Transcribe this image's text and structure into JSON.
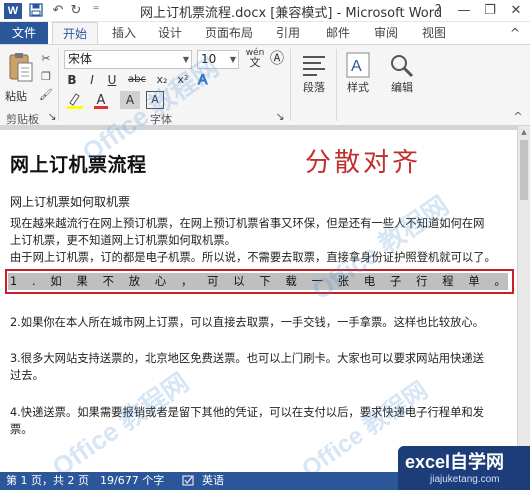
{
  "window": {
    "app_logo": "W",
    "title": "网上订机票流程.docx [兼容模式] - Microsoft Word",
    "help": "?",
    "minimize": "—",
    "restore": "❐",
    "close": "✕"
  },
  "qat": {
    "save": "💾",
    "undo": "↶",
    "redo": "↻",
    "more": "⁼"
  },
  "tabs": {
    "file": "文件",
    "items": [
      "开始",
      "插入",
      "设计",
      "页面布局",
      "引用",
      "邮件",
      "审阅",
      "视图"
    ],
    "active": "开始",
    "collapse": "^"
  },
  "ribbon": {
    "clipboard": {
      "paste": "粘贴",
      "group": "剪贴板"
    },
    "font": {
      "name": "宋体",
      "size": "10",
      "wen": "wén",
      "bold": "B",
      "italic": "I",
      "underline": "U",
      "strike": "abc",
      "sub": "x₂",
      "sup": "x²",
      "font_color": "A",
      "highlight": "A",
      "group": "字体"
    },
    "paragraph": {
      "label": "段落"
    },
    "styles": {
      "label": "样式"
    },
    "editing": {
      "label": "编辑"
    }
  },
  "doc": {
    "title": "网上订机票流程",
    "annotation": "分散对齐",
    "subtitle": "网上订机票如何取机票",
    "intro": [
      "现在越来越流行在网上预订机票，在网上预订机票省事又环保，但是还有一些人不知道如何在网",
      "上订机票，更不知道网上订机票如何取机票。",
      "由于网上订机票，订的都是电子机票。所以说，不需要去取票，直接拿身份证护照登机就可以了。"
    ],
    "selected_line": [
      "1",
      ".",
      "如",
      "果",
      "不",
      "放",
      "心",
      "，",
      "可",
      "以",
      "下",
      "载",
      "一",
      "张",
      "电",
      "子",
      "行",
      "程",
      "单",
      "。"
    ],
    "item2": [
      "2.如果你在本人所在城市网上订票，可以直接去取票，一手交钱，一手拿票。这样也比较放心。"
    ],
    "item3": [
      "3.很多大网站支持送票的，北京地区免费送票。也可以上门刷卡。大家也可以要求网站用快递送",
      "过去。"
    ],
    "item4": [
      "4.快递送票。如果需要报销或者是留下其他的凭证，可以在支付以后，要求快递电子行程单和发",
      "票。"
    ]
  },
  "status": {
    "page": "第 1 页，共 2 页",
    "words": "19/677 个字",
    "lang_icon": "英语"
  },
  "badge": {
    "main": "excel",
    "main_zh": "自学网",
    "url": "jiajuketang.com"
  },
  "watermark": "Office 教程网",
  "colors": {
    "accent": "#2b579a",
    "selection": "#bfbfbf",
    "highlight_box": "#c8202a",
    "annotation": "#c0302f"
  }
}
